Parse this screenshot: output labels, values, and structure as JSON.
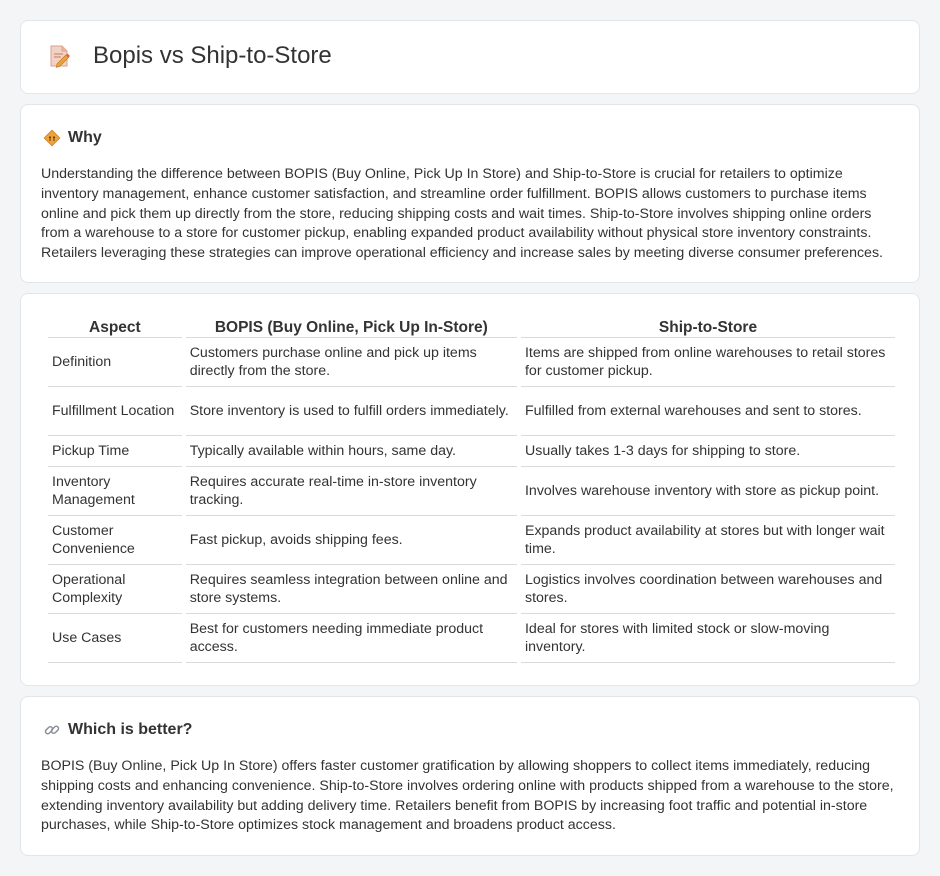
{
  "header": {
    "title": "Bopis vs Ship-to-Store",
    "icon": "document-pencil-icon"
  },
  "why": {
    "heading": "Why",
    "icon": "diamond-sign-icon",
    "text": "Understanding the difference between BOPIS (Buy Online, Pick Up In Store) and Ship-to-Store is crucial for retailers to optimize inventory management, enhance customer satisfaction, and streamline order fulfillment. BOPIS allows customers to purchase items online and pick them up directly from the store, reducing shipping costs and wait times. Ship-to-Store involves shipping online orders from a warehouse to a store for customer pickup, enabling expanded product availability without physical store inventory constraints. Retailers leveraging these strategies can improve operational efficiency and increase sales by meeting diverse consumer preferences."
  },
  "table": {
    "headers": [
      "Aspect",
      "BOPIS (Buy Online, Pick Up In-Store)",
      "Ship-to-Store"
    ],
    "rows": [
      [
        "Definition",
        "Customers purchase online and pick up items directly from the store.",
        "Items are shipped from online warehouses to retail stores for customer pickup."
      ],
      [
        "Fulfillment Location",
        "Store inventory is used to fulfill orders immediately.",
        "Fulfilled from external warehouses and sent to stores."
      ],
      [
        "Pickup Time",
        "Typically available within hours, same day.",
        "Usually takes 1-3 days for shipping to store."
      ],
      [
        "Inventory Management",
        "Requires accurate real-time in-store inventory tracking.",
        "Involves warehouse inventory with store as pickup point."
      ],
      [
        "Customer Convenience",
        "Fast pickup, avoids shipping fees.",
        "Expands product availability at stores but with longer wait time."
      ],
      [
        "Operational Complexity",
        "Requires seamless integration between online and store systems.",
        "Logistics involves coordination between warehouses and stores."
      ],
      [
        "Use Cases",
        "Best for customers needing immediate product access.",
        "Ideal for stores with limited stock or slow-moving inventory."
      ]
    ]
  },
  "better": {
    "heading": "Which is better?",
    "icon": "link-icon",
    "text": "BOPIS (Buy Online, Pick Up In Store) offers faster customer gratification by allowing shoppers to collect items immediately, reducing shipping costs and enhancing convenience. Ship-to-Store involves ordering online with products shipped from a warehouse to the store, extending inventory availability but adding delivery time. Retailers benefit from BOPIS by increasing foot traffic and potential in-store purchases, while Ship-to-Store optimizes stock management and broadens product access."
  },
  "colors": {
    "background": "#f4f5f7",
    "card": "#ffffff",
    "border": "#e3e5e8",
    "text": "#333333",
    "icon_accent": "#f0a23b"
  }
}
